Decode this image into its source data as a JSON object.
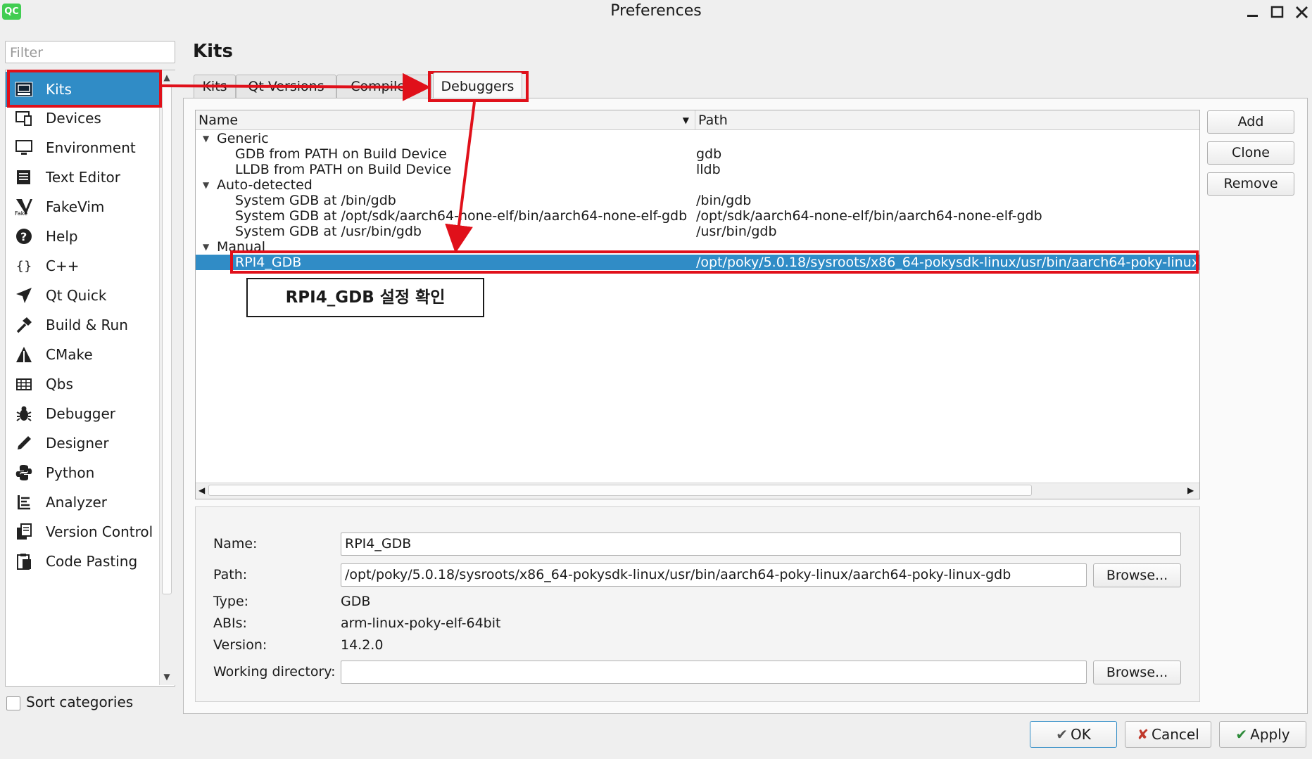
{
  "window": {
    "app_icon": "QC",
    "title": "Preferences",
    "controls": [
      "minimize-icon",
      "maximize-icon",
      "close-icon"
    ]
  },
  "sidebar": {
    "filter_placeholder": "Filter",
    "items": [
      {
        "label": "Kits",
        "icon": "kits-icon",
        "selected": true
      },
      {
        "label": "Devices",
        "icon": "devices-icon"
      },
      {
        "label": "Environment",
        "icon": "monitor-icon"
      },
      {
        "label": "Text Editor",
        "icon": "text-editor-icon"
      },
      {
        "label": "FakeVim",
        "icon": "fakevim-icon"
      },
      {
        "label": "Help",
        "icon": "help-icon"
      },
      {
        "label": "C++",
        "icon": "braces-icon"
      },
      {
        "label": "Qt Quick",
        "icon": "paper-plane-icon"
      },
      {
        "label": "Build & Run",
        "icon": "hammer-icon"
      },
      {
        "label": "CMake",
        "icon": "cmake-icon"
      },
      {
        "label": "Qbs",
        "icon": "qbs-icon"
      },
      {
        "label": "Debugger",
        "icon": "bug-icon"
      },
      {
        "label": "Designer",
        "icon": "pen-icon"
      },
      {
        "label": "Python",
        "icon": "python-icon"
      },
      {
        "label": "Analyzer",
        "icon": "analyzer-icon"
      },
      {
        "label": "Version Control",
        "icon": "version-control-icon"
      },
      {
        "label": "Code Pasting",
        "icon": "clipboard-icon"
      }
    ],
    "sort_label": "Sort categories",
    "sort_checked": false
  },
  "main": {
    "title": "Kits",
    "tabs": [
      {
        "label": "Kits"
      },
      {
        "label": "Qt Versions"
      },
      {
        "label": "Compilers"
      },
      {
        "label": "Debuggers",
        "active": true
      }
    ],
    "table": {
      "headers": {
        "name": "Name",
        "path": "Path"
      },
      "groups": [
        {
          "label": "Generic",
          "rows": [
            {
              "name": "GDB from PATH on Build Device",
              "path": "gdb"
            },
            {
              "name": "LLDB from PATH on Build Device",
              "path": "lldb"
            }
          ]
        },
        {
          "label": "Auto-detected",
          "rows": [
            {
              "name": "System GDB at /bin/gdb",
              "path": "/bin/gdb"
            },
            {
              "name": "System GDB at /opt/sdk/aarch64-none-elf/bin/aarch64-none-elf-gdb",
              "path": "/opt/sdk/aarch64-none-elf/bin/aarch64-none-elf-gdb"
            },
            {
              "name": "System GDB at /usr/bin/gdb",
              "path": "/usr/bin/gdb"
            }
          ]
        },
        {
          "label": "Manual",
          "rows": [
            {
              "name": "RPI4_GDB",
              "path": "/opt/poky/5.0.18/sysroots/x86_64-pokysdk-linux/usr/bin/aarch64-poky-linux/",
              "selected": true
            }
          ]
        }
      ]
    },
    "buttons": {
      "add": "Add",
      "clone": "Clone",
      "remove": "Remove"
    },
    "details": {
      "name_label": "Name:",
      "name_value": "RPI4_GDB",
      "path_label": "Path:",
      "path_value": "/opt/poky/5.0.18/sysroots/x86_64-pokysdk-linux/usr/bin/aarch64-poky-linux/aarch64-poky-linux-gdb",
      "browse_label": "Browse...",
      "type_label": "Type:",
      "type_value": "GDB",
      "abis_label": "ABIs:",
      "abis_value": "arm-linux-poky-elf-64bit",
      "version_label": "Version:",
      "version_value": "14.2.0",
      "workdir_label": "Working directory:",
      "workdir_value": ""
    }
  },
  "dialog_buttons": {
    "ok": "OK",
    "cancel": "Cancel",
    "apply": "Apply"
  },
  "annotation": {
    "callout": "RPI4_GDB 설정 확인",
    "color": "#e0101a"
  }
}
